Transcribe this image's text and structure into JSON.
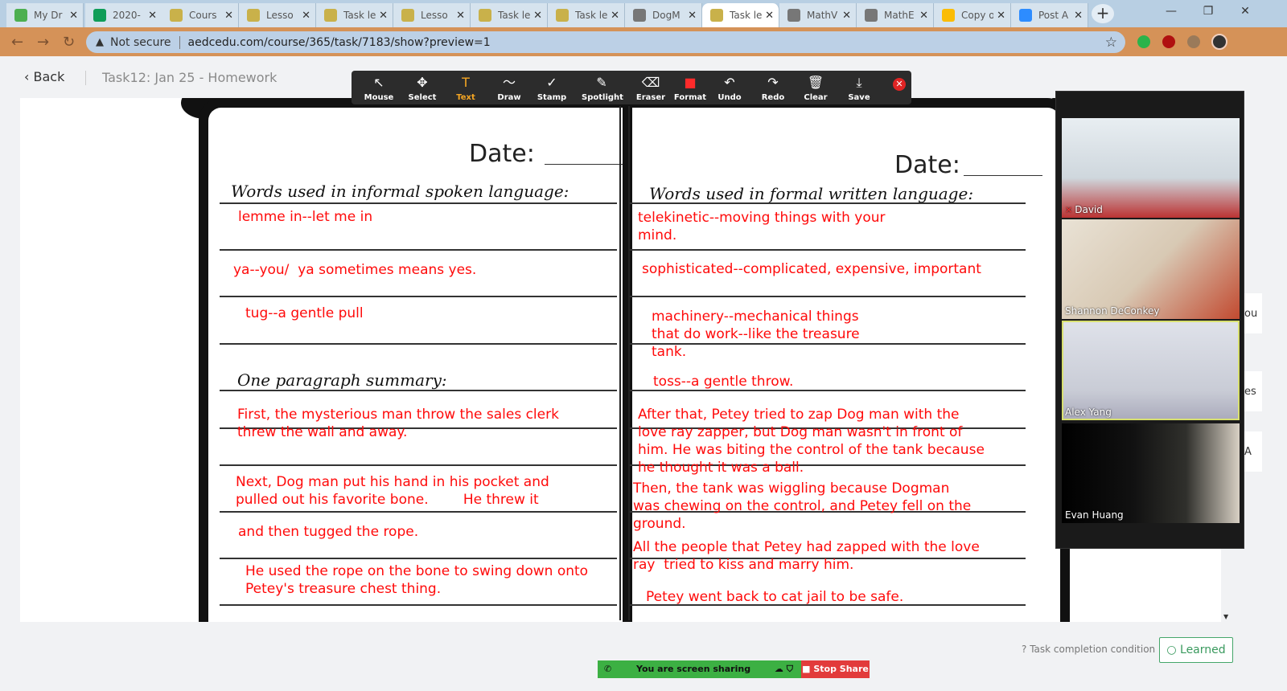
{
  "browser": {
    "tabs": [
      {
        "label": "My Dr",
        "color": "#4caf50"
      },
      {
        "label": "2020-",
        "color": "#0f9d58"
      },
      {
        "label": "Cours",
        "color": "#c9b14a"
      },
      {
        "label": "Lesso",
        "color": "#c9b14a"
      },
      {
        "label": "Task le",
        "color": "#c9b14a"
      },
      {
        "label": "Lesso",
        "color": "#c9b14a"
      },
      {
        "label": "Task le",
        "color": "#c9b14a"
      },
      {
        "label": "Task le",
        "color": "#c9b14a"
      },
      {
        "label": "DogM",
        "color": "#777777"
      },
      {
        "label": "Task le",
        "color": "#c9b14a"
      },
      {
        "label": "MathV",
        "color": "#777777"
      },
      {
        "label": "MathE",
        "color": "#777777"
      },
      {
        "label": "Copy o",
        "color": "#fbbc04"
      },
      {
        "label": "Post A",
        "color": "#2d8cff"
      }
    ],
    "security": "Not secure",
    "url": "aedcedu.com/course/365/task/7183/show?preview=1"
  },
  "header": {
    "back_label": "Back",
    "task_title": "Task12:  Jan 25 - Homework"
  },
  "annotation_tools": [
    {
      "label": "Mouse",
      "icon": "↖"
    },
    {
      "label": "Select",
      "icon": "✥"
    },
    {
      "label": "Text",
      "icon": "T"
    },
    {
      "label": "Draw",
      "icon": "〜"
    },
    {
      "label": "Stamp",
      "icon": "✓"
    },
    {
      "label": "Spotlight",
      "icon": "✎"
    },
    {
      "label": "Eraser",
      "icon": "⌫"
    },
    {
      "label": "Format",
      "icon": "■"
    },
    {
      "label": "Undo",
      "icon": "↶"
    },
    {
      "label": "Redo",
      "icon": "↷"
    },
    {
      "label": "Clear",
      "icon": "🗑"
    },
    {
      "label": "Save",
      "icon": "⤓"
    }
  ],
  "annotation_selected": "Text",
  "worksheet": {
    "date_label": "Date:",
    "left_heading": "Words used in informal spoken language:",
    "right_heading": "Words used in formal written language:",
    "summary_heading": "One paragraph summary:",
    "notes_left": [
      "lemme in--let me in",
      "ya--you/  ya sometimes means yes.",
      "tug--a gentle pull",
      "First, the mysterious man throw the sales clerk\nthrew the wall and away.",
      "Next, Dog man put his hand in his pocket and\npulled out his favorite bone.        He threw it",
      "and then tugged the rope.",
      "He used the rope on the bone to swing down onto\nPetey's treasure chest thing."
    ],
    "notes_right": [
      "telekinetic--moving things with your\nmind.",
      "sophisticated--complicated, expensive, important",
      "machinery--mechanical things\nthat do work--like the treasure\ntank.",
      "toss--a gentle throw.",
      "After that, Petey tried to zap Dog man with the\nlove ray zapper, but Dog man wasn't in front of\nhim. He was biting the control of the tank because\nhe thought it was a ball.",
      "Then, the tank was wiggling because Dogman\nwas chewing on the control, and Petey fell on the\nground.",
      "All the people that Petey had zapped with the love\nray  tried to kiss and marry him.",
      "Petey went back to cat jail to be safe."
    ]
  },
  "participants": [
    {
      "name": "David",
      "muted": true,
      "speaking": false
    },
    {
      "name": "Shannon DeConkey",
      "muted": false,
      "speaking": false
    },
    {
      "name": "Alex Yang",
      "muted": false,
      "speaking": true
    },
    {
      "name": "Evan Huang",
      "muted": false,
      "speaking": false
    }
  ],
  "edge_cards": [
    "ou",
    "es",
    "A"
  ],
  "footer": {
    "completion_condition": "Task completion condition",
    "learned_label": "○ Learned",
    "sharing_status": "You are screen sharing",
    "stop_share_label": "■ Stop Share"
  }
}
